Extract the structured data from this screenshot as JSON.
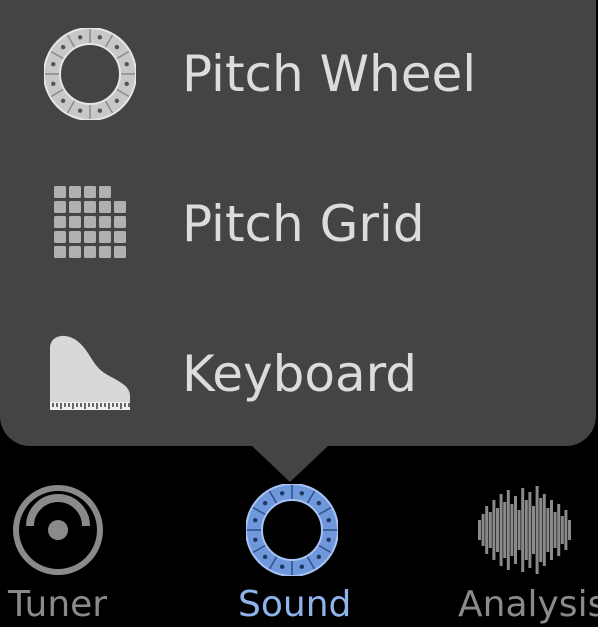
{
  "menu": {
    "items": [
      {
        "label": "Pitch Wheel",
        "icon": "pitch-wheel-icon"
      },
      {
        "label": "Pitch Grid",
        "icon": "grid-icon"
      },
      {
        "label": "Keyboard",
        "icon": "piano-icon"
      }
    ]
  },
  "nav": {
    "tabs": [
      {
        "label": "Tuner",
        "icon": "tuner-icon"
      },
      {
        "label": "Sound",
        "icon": "pitch-wheel-icon",
        "active": true
      },
      {
        "label": "Analysis",
        "icon": "waveform-icon"
      }
    ]
  },
  "colors": {
    "popup_bg": "#444444",
    "menu_text": "#dcdcdc",
    "inactive_tab": "#8a8a8a",
    "active_tab": "#8fb4ec",
    "background": "#000000"
  }
}
